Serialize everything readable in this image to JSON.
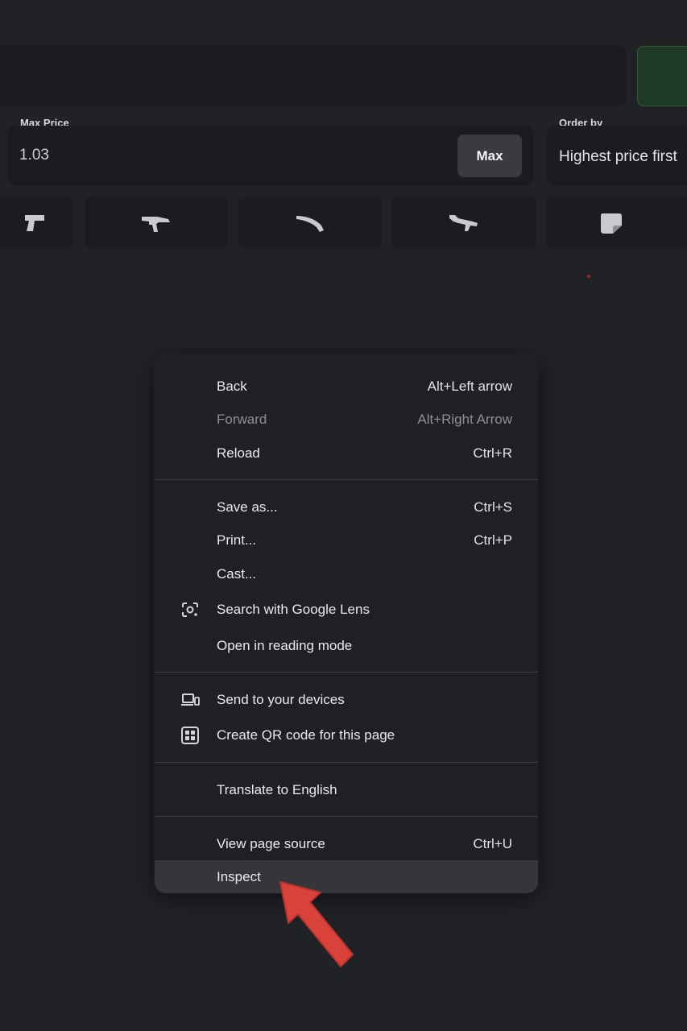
{
  "filters": {
    "max_price_label": "Max Price",
    "max_price_value": "1.03",
    "max_button": "Max",
    "order_by_label": "Order by",
    "order_by_value": "Highest price first"
  },
  "categories": [
    {
      "icon": "pistol-icon"
    },
    {
      "icon": "smg-icon"
    },
    {
      "icon": "knife-icon"
    },
    {
      "icon": "rifle-icon"
    },
    {
      "icon": "sticker-icon"
    }
  ],
  "context_menu": {
    "back": {
      "label": "Back",
      "shortcut": "Alt+Left arrow"
    },
    "forward": {
      "label": "Forward",
      "shortcut": "Alt+Right Arrow"
    },
    "reload": {
      "label": "Reload",
      "shortcut": "Ctrl+R"
    },
    "save_as": {
      "label": "Save as...",
      "shortcut": "Ctrl+S"
    },
    "print": {
      "label": "Print...",
      "shortcut": "Ctrl+P"
    },
    "cast": {
      "label": "Cast..."
    },
    "lens": {
      "label": "Search with Google Lens"
    },
    "reading_mode": {
      "label": "Open in reading mode"
    },
    "send_devices": {
      "label": "Send to your devices"
    },
    "qr_code": {
      "label": "Create QR code for this page"
    },
    "translate": {
      "label": "Translate to English"
    },
    "view_source": {
      "label": "View page source",
      "shortcut": "Ctrl+U"
    },
    "inspect": {
      "label": "Inspect"
    }
  },
  "colors": {
    "background": "#212226",
    "menu": "#1f2023",
    "highlight": "#35363a",
    "arrow": "#d9423b"
  }
}
